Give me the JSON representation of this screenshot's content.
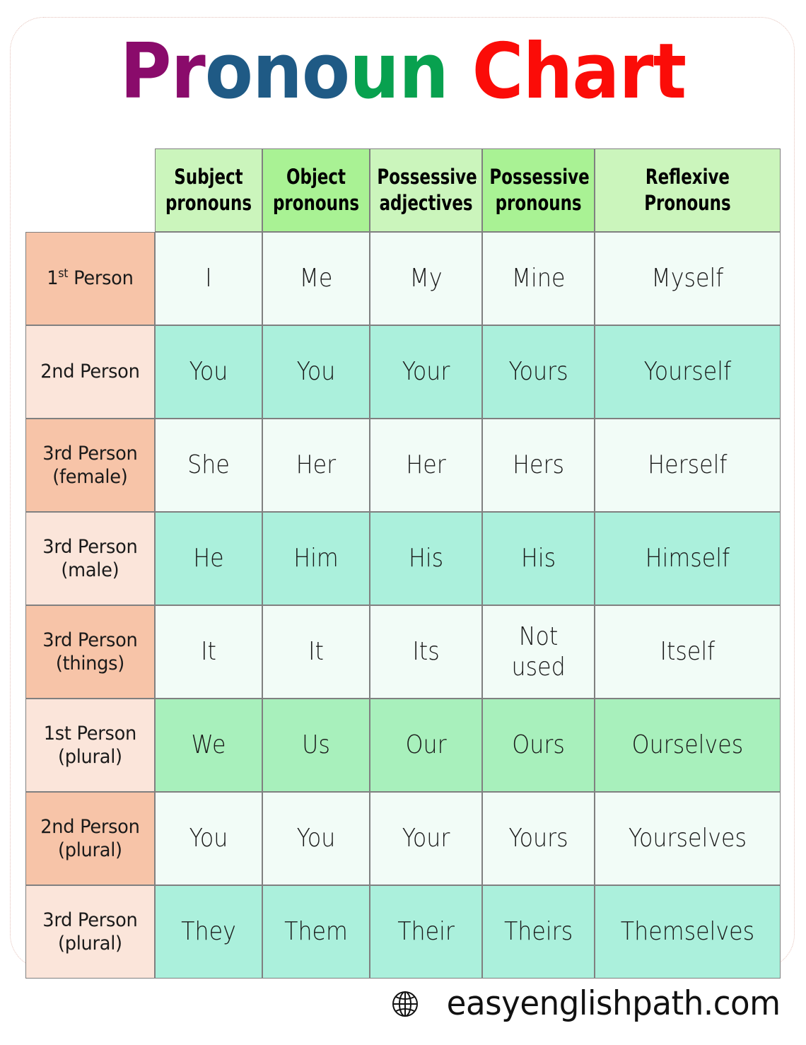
{
  "title": {
    "part1": "Pr",
    "part2": "ono",
    "part3": "un",
    "space": " ",
    "part4": "Chart",
    "full": "Pronoun Chart",
    "colors": {
      "part1": "#8A0B6B",
      "part2": "#1F5A85",
      "part3": "#08A14F",
      "part4": "#FB0C08"
    }
  },
  "table": {
    "corner_label": "",
    "headers": [
      {
        "line1": "Subject",
        "line2": "pronouns",
        "bg": "#CBF5BC"
      },
      {
        "line1": "Object",
        "line2": "pronouns",
        "bg": "#A9F294"
      },
      {
        "line1": "Possessive",
        "line2": "adjectives",
        "bg": "#CBF5BC"
      },
      {
        "line1": "Possessive",
        "line2": "pronouns",
        "bg": "#A9F294"
      },
      {
        "line1": "Reflexive",
        "line2": "Pronouns",
        "bg": "#CBF5BC"
      }
    ],
    "rows": [
      {
        "label_line1": "1st Person",
        "label_sup": "st",
        "label_pre": "1",
        "label_post": " Person",
        "label_line2": "",
        "label_bg": "#F7C4A8",
        "cell_bg": "#F2FCF7",
        "cells": [
          "I",
          "Me",
          "My",
          "Mine",
          "Myself"
        ]
      },
      {
        "label_line1": "2nd Person",
        "label_line2": "",
        "label_bg": "#FBE5DA",
        "cell_bg": "#ABF0DC",
        "cells": [
          "You",
          "You",
          "Your",
          "Yours",
          "Yourself"
        ]
      },
      {
        "label_line1": "3rd Person",
        "label_line2": "(female)",
        "label_bg": "#F7C4A8",
        "cell_bg": "#F2FCF7",
        "cells": [
          "She",
          "Her",
          "Her",
          "Hers",
          "Herself"
        ]
      },
      {
        "label_line1": "3rd Person",
        "label_line2": "(male)",
        "label_bg": "#FBE5DA",
        "cell_bg": "#ABF0DC",
        "cells": [
          "He",
          "Him",
          "His",
          "His",
          "Himself"
        ]
      },
      {
        "label_line1": "3rd Person",
        "label_line2": "(things)",
        "label_bg": "#F7C4A8",
        "cell_bg": "#F2FCF7",
        "cells": [
          "It",
          "It",
          "Its",
          "Not\nused",
          "Itself"
        ]
      },
      {
        "label_line1": "1st Person",
        "label_line2": "(plural)",
        "label_bg": "#FBE5DA",
        "cell_bg": "#A8F0BC",
        "cells": [
          "We",
          "Us",
          "Our",
          "Ours",
          "Ourselves"
        ]
      },
      {
        "label_line1": "2nd Person",
        "label_line2": "(plural)",
        "label_bg": "#F7C4A8",
        "cell_bg": "#F2FCF7",
        "cells": [
          "You",
          "You",
          "Your",
          "Yours",
          "Yourselves"
        ]
      },
      {
        "label_line1": "3rd Person",
        "label_line2": "(plural)",
        "label_bg": "#FBE5DA",
        "cell_bg": "#ABF0DC",
        "cells": [
          "They",
          "Them",
          "Their",
          "Theirs",
          "Themselves"
        ]
      }
    ]
  },
  "footer": {
    "icon": "globe-icon",
    "site": "easyenglishpath.com"
  }
}
